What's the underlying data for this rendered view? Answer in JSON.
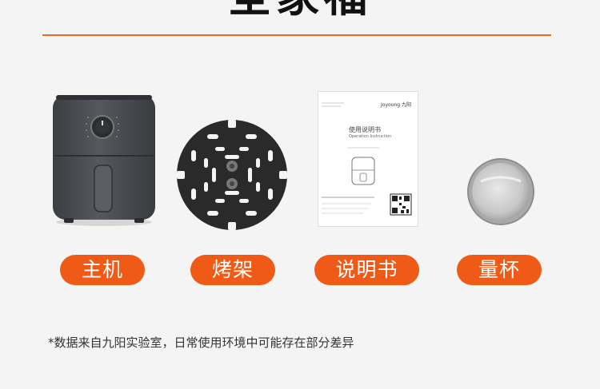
{
  "page": {
    "title": "全家福",
    "footnote": "*数据来自九阳实验室，日常使用环境中可能存在部分差异"
  },
  "items": [
    {
      "label": "主机",
      "image": "air-fryer-main-unit"
    },
    {
      "label": "烤架",
      "image": "grill-rack"
    },
    {
      "label": "说明书",
      "image": "instruction-manual"
    },
    {
      "label": "量杯",
      "image": "measuring-cup"
    }
  ],
  "manual": {
    "brand": "Joyoung 九阳",
    "heading_cn": "使用说明书",
    "heading_en": "Operation Instruction"
  },
  "colors": {
    "accent": "#ef5b16",
    "divider": "#e86b21",
    "background": "#f4f4f4",
    "appliance": "#4a4c50"
  }
}
